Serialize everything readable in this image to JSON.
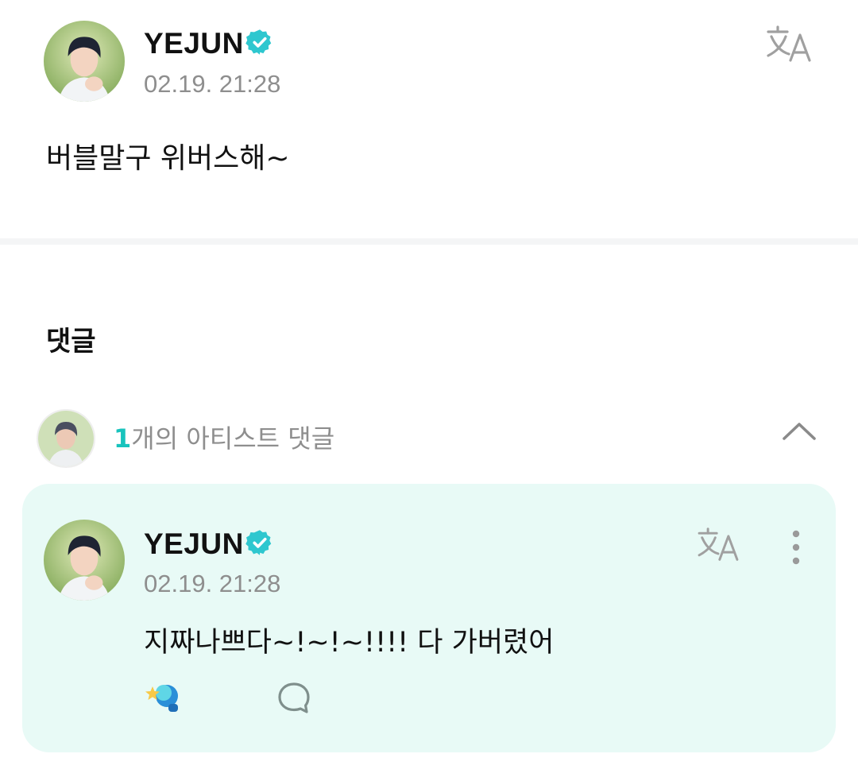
{
  "post": {
    "author": "YEJUN",
    "timestamp": "02.19. 21:28",
    "body": "버블말구 위버스해~"
  },
  "comments": {
    "section_title": "댓글",
    "artist_comment_count": "1",
    "artist_comment_label": "개의 아티스트 댓글"
  },
  "artist_comment": {
    "author": "YEJUN",
    "timestamp": "02.19. 21:28",
    "body": "지짜나쁘다~!~!~!!!! 다 가버렸어"
  },
  "icons": {
    "verified": "verified-badge-icon",
    "translate": "translate-icon",
    "collapse": "chevron-up-icon",
    "more": "more-vertical-icon",
    "cheer": "cheer-lightstick-icon",
    "reply": "reply-bubble-icon"
  },
  "colors": {
    "accent": "#18c3bd",
    "card_background": "#e8faf6",
    "muted_text": "#8e8e8e"
  }
}
